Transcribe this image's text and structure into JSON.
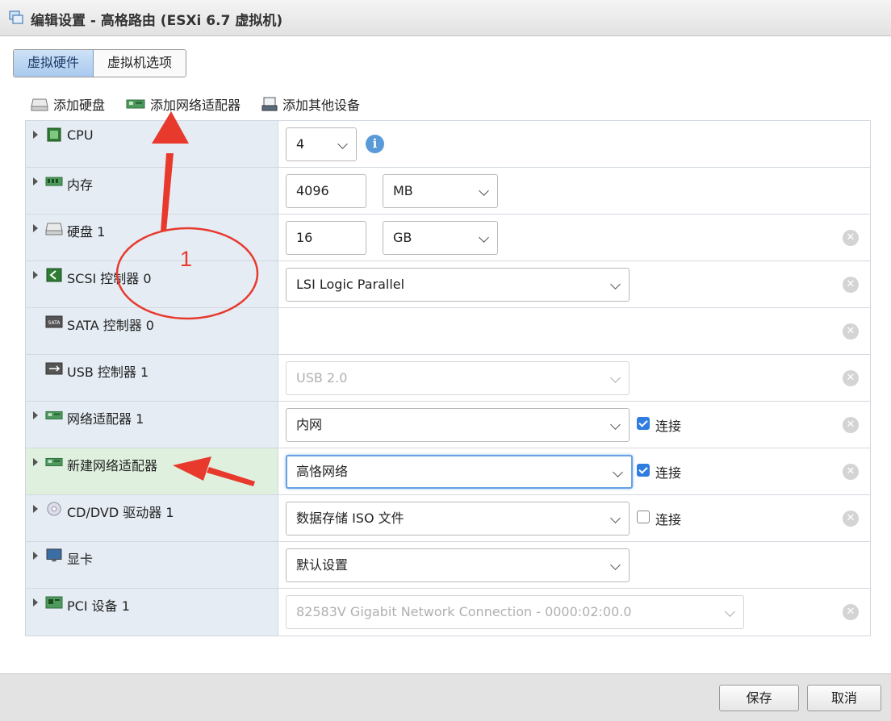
{
  "window": {
    "title": "编辑设置 - 高格路由 (ESXi 6.7 虚拟机)"
  },
  "tabs": [
    {
      "label": "虚拟硬件",
      "active": true
    },
    {
      "label": "虚拟机选项",
      "active": false
    }
  ],
  "toolbar": {
    "add_disk": "添加硬盘",
    "add_nic": "添加网络适配器",
    "add_other": "添加其他设备"
  },
  "devices": [
    {
      "label": "CPU",
      "value": "4",
      "icon": "cpu-icon",
      "expandable": true
    },
    {
      "label": "内存",
      "value": "4096",
      "unit": "MB",
      "icon": "memory-icon",
      "expandable": true
    },
    {
      "label": "硬盘 1",
      "value": "16",
      "unit": "GB",
      "icon": "disk-icon",
      "expandable": true
    },
    {
      "label": "SCSI 控制器 0",
      "value": "LSI Logic Parallel",
      "icon": "scsi-icon",
      "expandable": true
    },
    {
      "label": "SATA 控制器 0",
      "icon": "sata-icon",
      "expandable": false
    },
    {
      "label": "USB 控制器 1",
      "value": "USB 2.0",
      "icon": "usb-icon",
      "expandable": false,
      "disabled": true
    },
    {
      "label": "网络适配器 1",
      "value": "内网",
      "icon": "nic-icon",
      "expandable": true,
      "connect_label": "连接",
      "connected": true
    },
    {
      "label": "新建网络适配器",
      "value": "高恪网络",
      "icon": "nic-icon",
      "expandable": true,
      "connect_label": "连接",
      "connected": true
    },
    {
      "label": "CD/DVD 驱动器 1",
      "value": "数据存储 ISO 文件",
      "icon": "cd-icon",
      "expandable": true,
      "connect_label": "连接",
      "connected": false
    },
    {
      "label": "显卡",
      "value": "默认设置",
      "icon": "monitor-icon",
      "expandable": true
    },
    {
      "label": "PCI 设备 1",
      "value": "82583V Gigabit Network Connection - 0000:02:00.0",
      "icon": "pci-icon",
      "expandable": true,
      "disabled": true
    }
  ],
  "footer": {
    "save": "保存",
    "cancel": "取消"
  },
  "annotation": {
    "number": "1"
  },
  "colors": {
    "accent": "#2f7de1",
    "highlight_row": "#dff0de",
    "annotation_red": "#e8392d"
  }
}
